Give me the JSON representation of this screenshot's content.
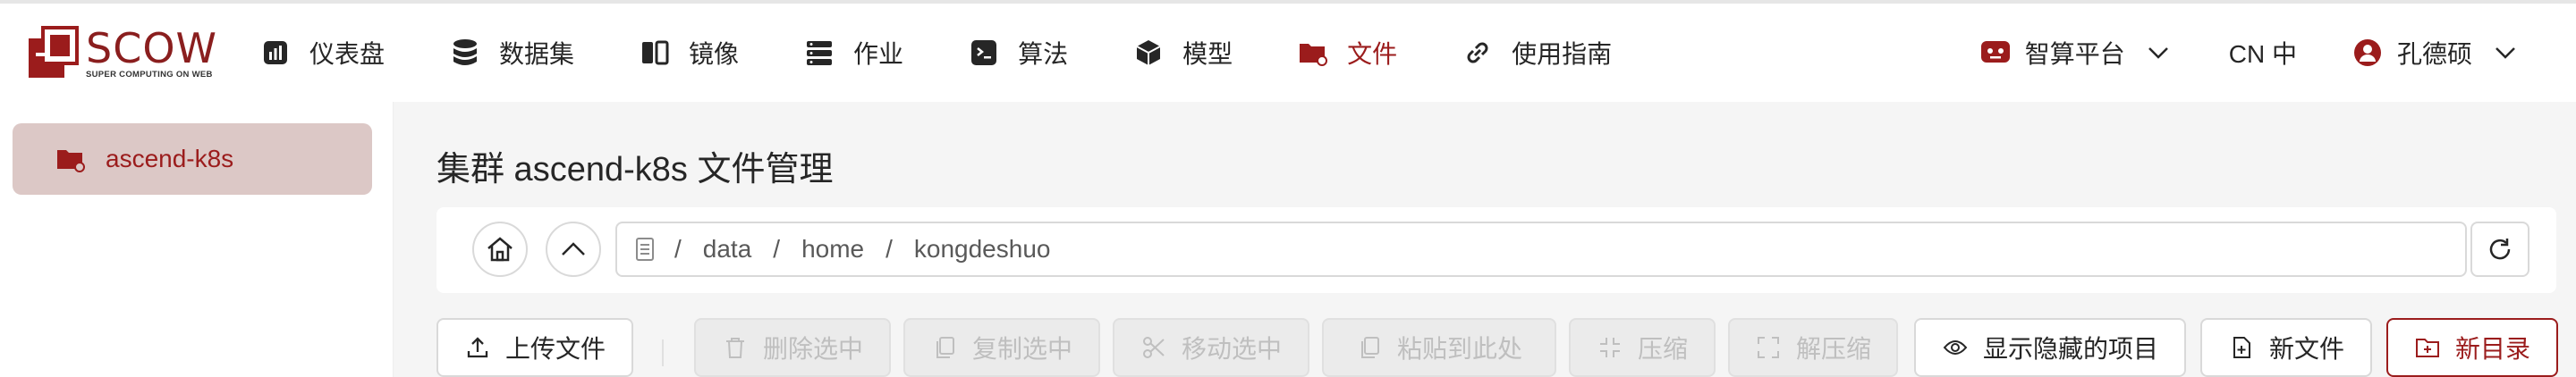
{
  "logo": {
    "title": "SCOW",
    "subtitle": "SUPER COMPUTING ON WEB"
  },
  "nav": [
    {
      "label": "仪表盘",
      "icon": "dashboard-icon"
    },
    {
      "label": "数据集",
      "icon": "database-icon"
    },
    {
      "label": "镜像",
      "icon": "image-icon"
    },
    {
      "label": "作业",
      "icon": "job-icon"
    },
    {
      "label": "算法",
      "icon": "algorithm-icon"
    },
    {
      "label": "模型",
      "icon": "model-cube-icon"
    },
    {
      "label": "文件",
      "icon": "folder-icon",
      "active": true
    },
    {
      "label": "使用指南",
      "icon": "link-icon"
    }
  ],
  "right_nav": {
    "platform": "智算平台",
    "language": "CN 中",
    "user": "孔德硕"
  },
  "sidebar": {
    "items": [
      {
        "label": "ascend-k8s",
        "active": true
      }
    ]
  },
  "main": {
    "title": "集群 ascend-k8s 文件管理",
    "path": {
      "segments": [
        "data",
        "home",
        "kongdeshuo"
      ],
      "separator": "/"
    }
  },
  "toolbar": {
    "upload": "上传文件",
    "delete_selected": "删除选中",
    "copy_selected": "复制选中",
    "move_selected": "移动选中",
    "paste_here": "粘贴到此处",
    "compress": "压缩",
    "decompress": "解压缩",
    "show_hidden": "显示隐藏的项目",
    "new_file": "新文件",
    "new_dir": "新目录"
  },
  "colors": {
    "accent": "#9b1c1c",
    "sidebar_active_bg": "#dcc8c6",
    "content_bg": "#f5f5f5"
  }
}
